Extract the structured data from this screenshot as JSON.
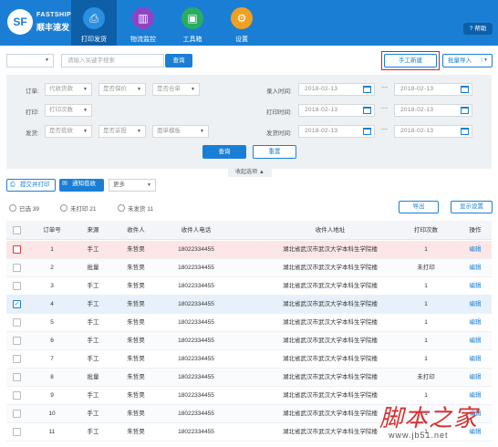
{
  "app": {
    "brand_en": "FASTSHIP",
    "brand_cn": "顺丰速发",
    "logo_text": "SF",
    "help": "帮助"
  },
  "nav": [
    {
      "label": "打印发货",
      "icon": "printer-icon",
      "color": "#2a8fe0"
    },
    {
      "label": "物流监控",
      "icon": "monitor-icon",
      "color": "#8e44c8"
    },
    {
      "label": "工具箱",
      "icon": "toolbox-icon",
      "color": "#27ae60"
    },
    {
      "label": "设置",
      "icon": "gear-icon",
      "color": "#f0a020"
    }
  ],
  "toolbar": {
    "search_placeholder": "请输入关键字搜索",
    "search_button": "查询",
    "manual_create": "手工新建",
    "bulk_import": "批量导入"
  },
  "filters": {
    "order_label": "订单:",
    "print_label": "打印:",
    "ship_label": "发货:",
    "order_opts": [
      "代收货款",
      "是否保价",
      "是否合单"
    ],
    "print_opts": [
      "打印次数"
    ],
    "ship_opts": [
      "是否揽收",
      "是否妥投",
      "面单模板"
    ],
    "entry_time_label": "录入时间:",
    "print_time_label": "打印时间:",
    "ship_time_label": "发货时间:",
    "date_value": "2018-02-13",
    "query_button": "查询",
    "reset_button": "重置",
    "collapse": "收起选项"
  },
  "actions": {
    "submit_print": "提交并打印",
    "notify_pickup": "通知揽收",
    "more": "更多",
    "selected": "已选 39",
    "unprinted": "未打印 21",
    "unshipped": "未发货 11",
    "export": "导出",
    "display_settings": "显示设置"
  },
  "table": {
    "headers": [
      "订单号",
      "来源",
      "收件人",
      "收件人电话",
      "收件人地址",
      "打印次数",
      "操作"
    ],
    "rows": [
      {
        "id": "1",
        "source": "手工",
        "name": "朱哲昊",
        "phone": "18022334455",
        "addr": "湖北省武汉市武汉大学本科生学院楼",
        "prints": "1",
        "op": "编辑",
        "state": "red"
      },
      {
        "id": "2",
        "source": "批量",
        "name": "朱哲昊",
        "phone": "18022334455",
        "addr": "湖北省武汉市武汉大学本科生学院楼",
        "prints": "未打印",
        "op": "编辑",
        "state": ""
      },
      {
        "id": "3",
        "source": "手工",
        "name": "朱哲昊",
        "phone": "18022334455",
        "addr": "湖北省武汉市武汉大学本科生学院楼",
        "prints": "1",
        "op": "编辑",
        "state": ""
      },
      {
        "id": "4",
        "source": "手工",
        "name": "朱哲昊",
        "phone": "18022334455",
        "addr": "湖北省武汉市武汉大学本科生学院楼",
        "prints": "1",
        "op": "编辑",
        "state": "blue"
      },
      {
        "id": "5",
        "source": "手工",
        "name": "朱哲昊",
        "phone": "18022334455",
        "addr": "湖北省武汉市武汉大学本科生学院楼",
        "prints": "1",
        "op": "编辑",
        "state": ""
      },
      {
        "id": "6",
        "source": "手工",
        "name": "朱哲昊",
        "phone": "18022334455",
        "addr": "湖北省武汉市武汉大学本科生学院楼",
        "prints": "1",
        "op": "编辑",
        "state": ""
      },
      {
        "id": "7",
        "source": "手工",
        "name": "朱哲昊",
        "phone": "18022334455",
        "addr": "湖北省武汉市武汉大学本科生学院楼",
        "prints": "1",
        "op": "编辑",
        "state": ""
      },
      {
        "id": "8",
        "source": "批量",
        "name": "朱哲昊",
        "phone": "18022334455",
        "addr": "湖北省武汉市武汉大学本科生学院楼",
        "prints": "未打印",
        "op": "编辑",
        "state": ""
      },
      {
        "id": "9",
        "source": "手工",
        "name": "朱哲昊",
        "phone": "18022334455",
        "addr": "湖北省武汉市武汉大学本科生学院楼",
        "prints": "1",
        "op": "编辑",
        "state": ""
      },
      {
        "id": "10",
        "source": "手工",
        "name": "朱哲昊",
        "phone": "18022334455",
        "addr": "湖北省武汉市武汉大学本科生学院楼",
        "prints": "1",
        "op": "编辑",
        "state": ""
      },
      {
        "id": "11",
        "source": "手工",
        "name": "朱哲昊",
        "phone": "18022334455",
        "addr": "湖北省武汉市武汉大学本科生学院楼",
        "prints": "1",
        "op": "编辑",
        "state": ""
      }
    ]
  },
  "watermark": {
    "cn": "脚本之家",
    "url": "www.jb51.net"
  }
}
